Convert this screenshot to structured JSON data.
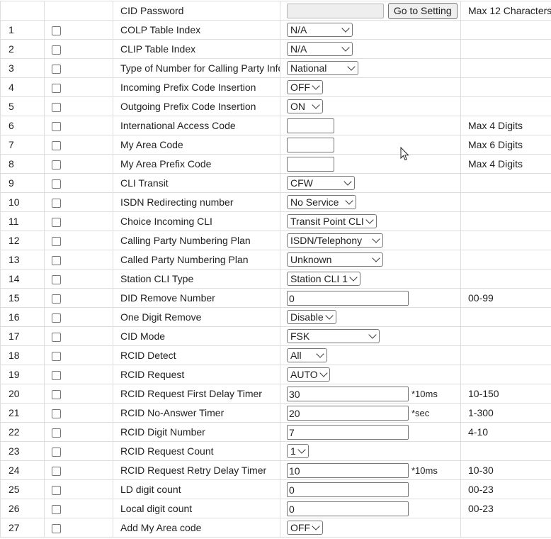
{
  "header": {
    "label": "CID Password",
    "button": "Go to Setting",
    "note": "Max 12 Characters"
  },
  "rows": [
    {
      "num": "1",
      "label": "COLP Table Index",
      "type": "select",
      "value": "N/A",
      "note": ""
    },
    {
      "num": "2",
      "label": "CLIP Table Index",
      "type": "select",
      "value": "N/A",
      "note": ""
    },
    {
      "num": "3",
      "label": "Type of Number for Calling Party Info",
      "type": "select",
      "value": "National",
      "note": ""
    },
    {
      "num": "4",
      "label": "Incoming Prefix Code Insertion",
      "type": "select",
      "value": "OFF",
      "note": ""
    },
    {
      "num": "5",
      "label": "Outgoing Prefix Code Insertion",
      "type": "select",
      "value": "ON",
      "note": ""
    },
    {
      "num": "6",
      "label": "International Access Code",
      "type": "short-input",
      "value": "",
      "note": "Max 4 Digits"
    },
    {
      "num": "7",
      "label": "My Area Code",
      "type": "short-input",
      "value": "",
      "note": "Max 6 Digits"
    },
    {
      "num": "8",
      "label": "My Area Prefix Code",
      "type": "short-input",
      "value": "",
      "note": "Max 4 Digits"
    },
    {
      "num": "9",
      "label": "CLI Transit",
      "type": "select",
      "value": "CFW",
      "note": ""
    },
    {
      "num": "10",
      "label": "ISDN Redirecting number",
      "type": "select",
      "value": "No Service",
      "note": ""
    },
    {
      "num": "11",
      "label": "Choice Incoming CLI",
      "type": "select",
      "value": "Transit Point CLI",
      "note": ""
    },
    {
      "num": "12",
      "label": "Calling Party Numbering Plan",
      "type": "select",
      "value": "ISDN/Telephony",
      "note": ""
    },
    {
      "num": "13",
      "label": "Called Party Numbering Plan",
      "type": "select",
      "value": "Unknown",
      "note": ""
    },
    {
      "num": "14",
      "label": "Station CLI Type",
      "type": "select",
      "value": "Station CLI 1",
      "note": ""
    },
    {
      "num": "15",
      "label": "DID Remove Number",
      "type": "input",
      "value": "0",
      "unit": "",
      "note": "00-99"
    },
    {
      "num": "16",
      "label": "One Digit Remove",
      "type": "select",
      "value": "Disable",
      "note": ""
    },
    {
      "num": "17",
      "label": "CID Mode",
      "type": "select",
      "value": "FSK",
      "note": ""
    },
    {
      "num": "18",
      "label": "RCID Detect",
      "type": "select",
      "value": "All",
      "note": ""
    },
    {
      "num": "19",
      "label": "RCID Request",
      "type": "select",
      "value": "AUTO",
      "note": ""
    },
    {
      "num": "20",
      "label": "RCID Request First Delay Timer",
      "type": "input",
      "value": "30",
      "unit": "*10ms",
      "note": "10-150"
    },
    {
      "num": "21",
      "label": "RCID No-Answer Timer",
      "type": "input",
      "value": "20",
      "unit": "*sec",
      "note": "1-300"
    },
    {
      "num": "22",
      "label": "RCID Digit Number",
      "type": "input",
      "value": "7",
      "unit": "",
      "note": "4-10"
    },
    {
      "num": "23",
      "label": "RCID Request Count",
      "type": "select",
      "value": "1",
      "note": ""
    },
    {
      "num": "24",
      "label": "RCID Request Retry Delay Timer",
      "type": "input",
      "value": "10",
      "unit": "*10ms",
      "note": "10-30"
    },
    {
      "num": "25",
      "label": "LD digit count",
      "type": "input",
      "value": "0",
      "unit": "",
      "note": "00-23"
    },
    {
      "num": "26",
      "label": "Local digit count",
      "type": "input",
      "value": "0",
      "unit": "",
      "note": "00-23"
    },
    {
      "num": "27",
      "label": "Add My Area code",
      "type": "select",
      "value": "OFF",
      "note": ""
    }
  ]
}
